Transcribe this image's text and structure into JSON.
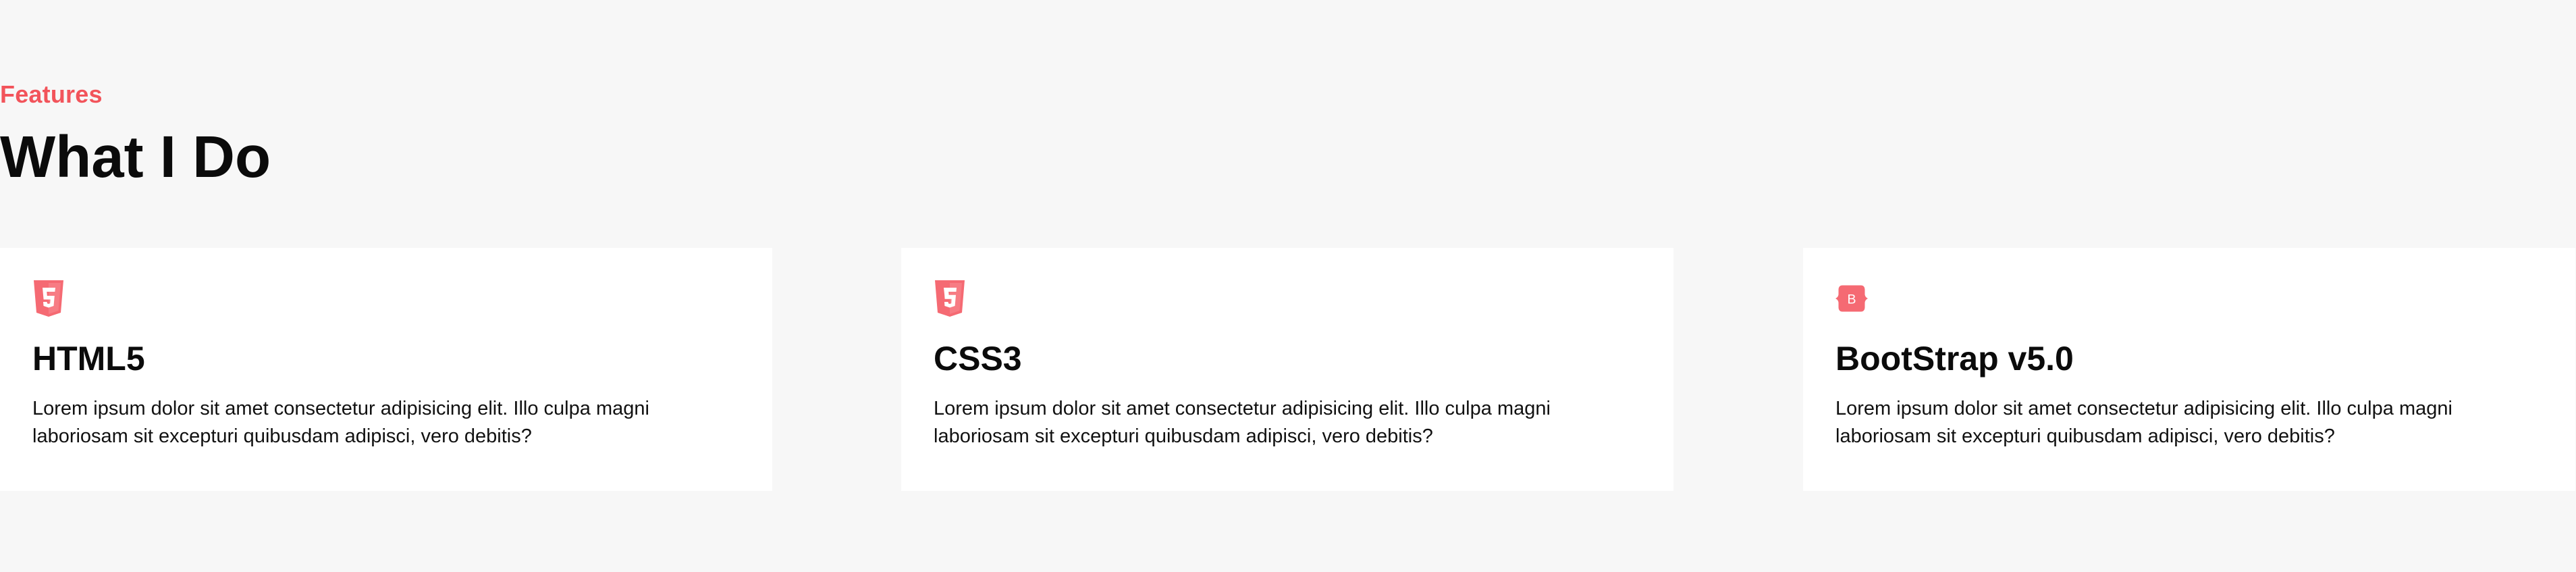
{
  "section": {
    "eyebrow": "Features",
    "title": "What I Do"
  },
  "cards": [
    {
      "title": "HTML5",
      "icon": "html5-icon",
      "text": "Lorem ipsum dolor sit amet consectetur adipisicing elit. Illo culpa magni laboriosam sit excepturi quibusdam adipisci, vero debitis?"
    },
    {
      "title": "CSS3",
      "icon": "css3-icon",
      "text": "Lorem ipsum dolor sit amet consectetur adipisicing elit. Illo culpa magni laboriosam sit excepturi quibusdam adipisci, vero debitis?"
    },
    {
      "title": "BootStrap v5.0",
      "icon": "bootstrap-icon",
      "text": "Lorem ipsum dolor sit amet consectetur adipisicing elit. Illo culpa magni laboriosam sit excepturi quibusdam adipisci, vero debitis?"
    }
  ],
  "colors": {
    "accent": "#f2545b",
    "icon": "#f56a73",
    "background": "#f7f7f7",
    "card": "#ffffff",
    "text": "#0b0b0b"
  }
}
